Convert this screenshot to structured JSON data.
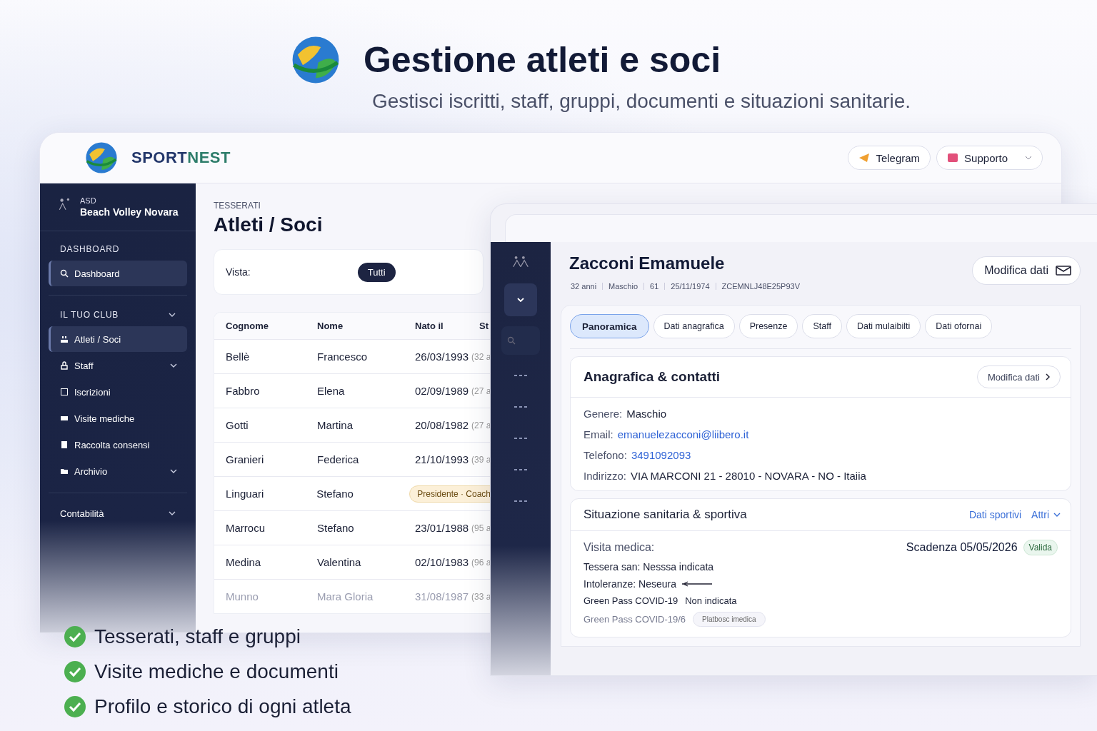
{
  "hero": {
    "title": "Gestione atleti e soci",
    "subtitle": "Gestisci iscritti, staff, gruppi, documenti e situazioni sanitarie."
  },
  "app": {
    "brand_dark": "SPORT",
    "brand_accent": "NEST",
    "top_buttons": [
      {
        "kind": "telegram",
        "label": "Telegram"
      },
      {
        "kind": "support",
        "label": "Supporto"
      }
    ]
  },
  "sidebar": {
    "club_prefix": "ASD",
    "club_name": "Beach Volley Novara",
    "items": [
      {
        "kind": "heading",
        "label": "DASHBOARD",
        "expandable": false
      },
      {
        "kind": "item",
        "label": "Dashboard",
        "expandable": false,
        "selected": true
      },
      {
        "kind": "heading",
        "label": "IL TUO CLUB",
        "expandable": true
      },
      {
        "kind": "item",
        "label": "Atleti / Soci",
        "expandable": false,
        "selected": true
      },
      {
        "kind": "item",
        "label": "Staff",
        "expandable": true,
        "selected": false
      },
      {
        "kind": "item",
        "label": "Iscrizioni",
        "expandable": false,
        "selected": false
      },
      {
        "kind": "item",
        "label": "Visite mediche",
        "expandable": false,
        "selected": false
      },
      {
        "kind": "item",
        "label": "Raccolta consensi",
        "expandable": false,
        "selected": false
      },
      {
        "kind": "item",
        "label": "Archivio",
        "expandable": true,
        "selected": false
      },
      {
        "kind": "group",
        "label": "Contabilità",
        "expandable": true
      }
    ]
  },
  "content": {
    "section": "TESSERATI",
    "title": "Atleti / Soci",
    "view_label": "Vista:",
    "view_chip": "Tutti",
    "table": {
      "columns": [
        "Cognome",
        "Nome",
        "Nato il",
        "St"
      ],
      "rows": [
        {
          "surname": "Bellè",
          "name": "Francesco",
          "born": "26/03/1993",
          "age": "(32 a"
        },
        {
          "surname": "Fabbro",
          "name": "Elena",
          "born": "02/09/1989",
          "age": "(27 a"
        },
        {
          "surname": "Gotti",
          "name": "Martina",
          "born": "20/08/1982",
          "age": "(27 a"
        },
        {
          "surname": "Granieri",
          "name": "Federica",
          "born": "21/10/1993",
          "age": "(39 a"
        },
        {
          "surname": "Linguari",
          "name": "Stefano",
          "badge": "Presidente · Coach"
        },
        {
          "surname": "Marrocu",
          "name": "Stefano",
          "born": "23/01/1988",
          "age": "(95 a"
        },
        {
          "surname": "Medina",
          "name": "Valentina",
          "born": "02/10/1983",
          "age": "(96 a"
        },
        {
          "surname": "Munno",
          "name": "Mara Gloria",
          "born": "31/08/1987",
          "age": "(33 a"
        }
      ]
    }
  },
  "detail": {
    "name": "Zacconi Emamuele",
    "meta": [
      "32 anni",
      "Maschio",
      "61",
      "25/11/1974",
      "ZCEMNLJ48E25P93V"
    ],
    "edit_button": "Modifica dati",
    "tabs": [
      {
        "label": "Panoramica",
        "selected": true
      },
      {
        "label": "Dati anagrafica",
        "selected": false
      },
      {
        "label": "Presenze",
        "selected": false
      },
      {
        "label": "Staff",
        "selected": false
      },
      {
        "label": "Dati mulaibilti",
        "selected": false
      },
      {
        "label": "Dati ofornai",
        "selected": false
      }
    ],
    "contacts": {
      "title": "Anagrafica & contatti",
      "button": "Modifica dati",
      "fields": [
        {
          "label": "Genere:",
          "value": "Maschio",
          "kind": "text"
        },
        {
          "label": "Email:",
          "value": "emanuelezacconi@liibero.it",
          "kind": "link"
        },
        {
          "label": "Telefono:",
          "value": "3491092093",
          "kind": "link"
        },
        {
          "label": "Indirizzo:",
          "value": "VIA MARCONI 21 - 28010 - NOVARA - NO - Itaiia",
          "kind": "text"
        }
      ]
    },
    "health": {
      "title": "Situazione sanitaria & sportiva",
      "links": [
        "Dati sportivi",
        "Attri"
      ],
      "visit_label": "Visita medica:",
      "expiry": "Scadenza 05/05/2026",
      "status": "Valida",
      "lines": [
        {
          "kind": "plain",
          "label": "Tessera san: Nesssa indicata"
        },
        {
          "kind": "arrow",
          "label": "Intoleranze: Neseura"
        },
        {
          "kind": "pair",
          "label": "Green Pass COVID-19",
          "value": "Non indicata"
        },
        {
          "kind": "chip",
          "label": "Green Pass COVID-19/6",
          "value": "Platbosc imedica"
        }
      ]
    }
  },
  "features": [
    "Tesserati, staff e gruppi",
    "Visite mediche e documenti",
    "Profilo e storico di ogni atleta"
  ]
}
